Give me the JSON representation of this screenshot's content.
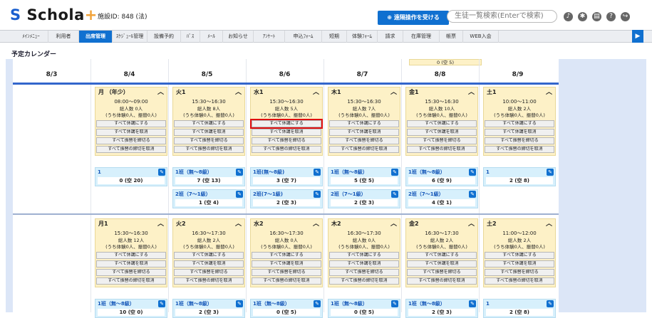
{
  "header": {
    "logo_text": "Schola",
    "logo_plus": "+",
    "facility": "施設ID: 848 (法)",
    "remote_button": "遠隔操作を受ける",
    "search_placeholder": "生徒一覧検索(Enterで検索)",
    "icons": [
      "bell-icon",
      "gear-icon",
      "document-icon",
      "help-icon",
      "logout-icon"
    ]
  },
  "nav": {
    "items": [
      "ﾒｲﾝﾒﾆｭｰ",
      "利用者",
      "出席管理",
      "ｽｹｼﾞｭｰﾙ管理",
      "設備予約",
      "ﾊﾞｽ",
      "ﾒｰﾙ",
      "お知らせ",
      "ｱﾝｹｰﾄ",
      "申込ﾌｫｰﾑ",
      "短期",
      "体験ﾌｫｰﾑ",
      "請求",
      "在庫管理",
      "帳票",
      "WEB入会"
    ],
    "active_index": 2
  },
  "page_title": "予定カレンダー",
  "partial_card_text": "0 (空 5)",
  "dates": [
    "8/3",
    "8/4",
    "8/5",
    "8/6",
    "8/7",
    "8/8",
    "8/9"
  ],
  "buttons": [
    "すべて休講にする",
    "すべて休講を取消",
    "すべて振替を締切る",
    "すべて振替の締切を取消"
  ],
  "rows": [
    {
      "cards": [
        {
          "head": "月 （年少）",
          "time": "08:00〜09:00",
          "total": "総人数 0人",
          "sub": "(うち体験0人、振替0人)",
          "groups": [
            {
              "name": "1",
              "count": "0 (空 20)"
            }
          ]
        },
        {
          "head": "火1",
          "time": "15:30〜16:30",
          "total": "総人数 8人",
          "sub": "(うち体験0人、振替0人)",
          "groups": [
            {
              "name": "1班（無〜8級）",
              "count": "7 (空 13)"
            },
            {
              "name": "2班（7〜1級）",
              "count": "1 (空 4)"
            }
          ]
        },
        {
          "head": "水1",
          "time": "15:30〜16:30",
          "total": "総人数 5人",
          "sub": "(うち体験0人、振替0人)",
          "groups": [
            {
              "name": "1班(無〜8級)",
              "count": "3 (空 7)"
            },
            {
              "name": "2班(7〜1級)",
              "count": "2 (空 3)"
            }
          ]
        },
        {
          "head": "木1",
          "time": "15:30〜16:30",
          "total": "総人数 7人",
          "sub": "(うち体験0人、振替0人)",
          "groups": [
            {
              "name": "1班（無〜8級）",
              "count": "5 (空 5)"
            },
            {
              "name": "2班（7〜1級）",
              "count": "2 (空 3)"
            }
          ]
        },
        {
          "head": "金1",
          "time": "15:30〜16:30",
          "total": "総人数 10人",
          "sub": "(うち体験0人、振替0人)",
          "groups": [
            {
              "name": "1班（無〜8級）",
              "count": "6 (空 9)"
            },
            {
              "name": "2班（7〜1級）",
              "count": "4 (空 1)"
            }
          ]
        },
        {
          "head": "土1",
          "time": "10:00〜11:00",
          "total": "総人数 2人",
          "sub": "(うち体験0人、振替0人)",
          "groups": [
            {
              "name": "1",
              "count": "2 (空 8)"
            }
          ]
        }
      ]
    },
    {
      "cards": [
        {
          "head": "月1",
          "time": "15:30〜16:30",
          "total": "総人数 12人",
          "sub": "(うち体験0人、振替0人)",
          "groups": [
            {
              "name": "1班（無〜8級）",
              "count": "10 (空 0)"
            }
          ]
        },
        {
          "head": "火2",
          "time": "16:30〜17:30",
          "total": "総人数 2人",
          "sub": "(うち体験0人、振替0人)",
          "groups": [
            {
              "name": "1班（無〜8級）",
              "count": "2 (空 3)"
            }
          ]
        },
        {
          "head": "水2",
          "time": "16:30〜17:30",
          "total": "総人数 0人",
          "sub": "(うち体験0人、振替0人)",
          "groups": [
            {
              "name": "1班（無〜8級）",
              "count": "0 (空 5)"
            }
          ]
        },
        {
          "head": "木2",
          "time": "16:30〜17:30",
          "total": "総人数 0人",
          "sub": "(うち体験0人、振替0人)",
          "groups": [
            {
              "name": "1班（無〜8級）",
              "count": "0 (空 5)"
            }
          ]
        },
        {
          "head": "金2",
          "time": "16:30〜17:30",
          "total": "総人数 2人",
          "sub": "(うち体験0人、振替0人)",
          "groups": [
            {
              "name": "1班（無〜8級）",
              "count": "2 (空 3)"
            }
          ]
        },
        {
          "head": "土2",
          "time": "11:00〜12:00",
          "total": "総人数 2人",
          "sub": "(うち体験0人、振替0人)",
          "groups": [
            {
              "name": "1",
              "count": "2 (空 8)"
            }
          ]
        }
      ]
    }
  ]
}
